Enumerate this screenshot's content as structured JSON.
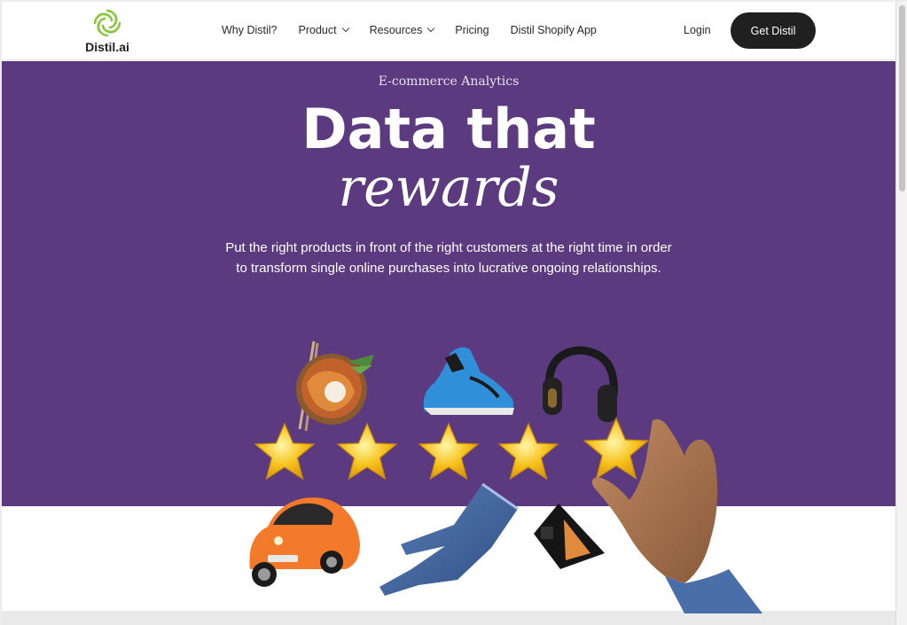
{
  "brand": {
    "name": "Distil.ai",
    "logo_color": "#8cc63f"
  },
  "nav": {
    "items": [
      {
        "label": "Why Distil?",
        "dropdown": false
      },
      {
        "label": "Product",
        "dropdown": true
      },
      {
        "label": "Resources",
        "dropdown": true
      },
      {
        "label": "Pricing",
        "dropdown": false
      },
      {
        "label": "Distil Shopify App",
        "dropdown": false
      }
    ],
    "login": "Login",
    "cta": "Get Distil"
  },
  "hero": {
    "eyebrow": "E-commerce Analytics",
    "headline": "Data that",
    "headline_italic": "rewards",
    "subtext": "Put the right products in front of the right customers at the right time in order to transform single online purchases into lucrative ongoing relationships.",
    "background_color": "#5c3a80",
    "rating_stars": 5,
    "product_images": [
      "food-bowl",
      "sneaker",
      "headphones",
      "car",
      "jeans",
      "makeup-palette",
      "hand"
    ]
  }
}
